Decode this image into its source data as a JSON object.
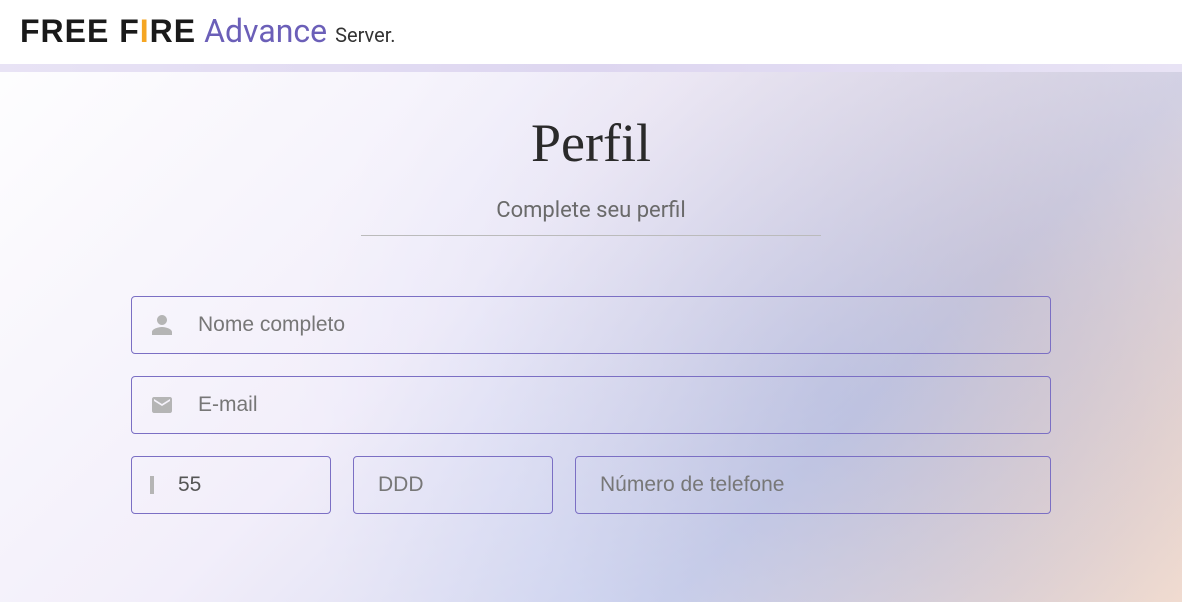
{
  "header": {
    "logo_free": "FREE F",
    "logo_flame": "I",
    "logo_re": "RE",
    "logo_advance": "Advance",
    "logo_server": "Server."
  },
  "page": {
    "title": "Perfil",
    "subtitle": "Complete seu perfil"
  },
  "form": {
    "name_placeholder": "Nome completo",
    "email_placeholder": "E-mail",
    "country_code": "55",
    "ddd_placeholder": "DDD",
    "phone_placeholder": "Número de telefone"
  }
}
